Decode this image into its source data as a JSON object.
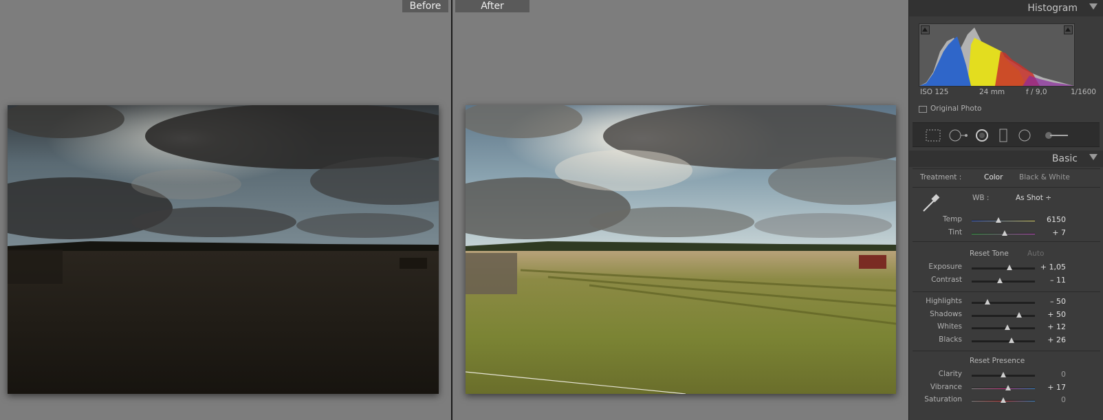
{
  "compare": {
    "before_label": "Before",
    "after_label": "After"
  },
  "histogram": {
    "title": "Histogram",
    "iso": "ISO 125",
    "focal": "24 mm",
    "aperture": "f / 9,0",
    "shutter": "1/1600",
    "original_photo": "Original Photo"
  },
  "basic": {
    "title": "Basic",
    "treatment_label": "Treatment :",
    "treatment_color": "Color",
    "treatment_bw": "Black & White",
    "wb_label": "WB :",
    "wb_value": "As Shot ÷",
    "temp": {
      "label": "Temp",
      "value": "6150",
      "pos": 0.42
    },
    "tint": {
      "label": "Tint",
      "value": "+ 7",
      "pos": 0.52
    },
    "reset_tone": "Reset Tone",
    "auto": "Auto",
    "exposure": {
      "label": "Exposure",
      "value": "+ 1,05",
      "pos": 0.6
    },
    "contrast": {
      "label": "Contrast",
      "value": "– 11",
      "pos": 0.45
    },
    "highlights": {
      "label": "Highlights",
      "value": "– 50",
      "pos": 0.25
    },
    "shadows": {
      "label": "Shadows",
      "value": "+ 50",
      "pos": 0.75
    },
    "whites": {
      "label": "Whites",
      "value": "+ 12",
      "pos": 0.56
    },
    "blacks": {
      "label": "Blacks",
      "value": "+ 26",
      "pos": 0.63
    },
    "reset_presence": "Reset Presence",
    "clarity": {
      "label": "Clarity",
      "value": "0",
      "pos": 0.5
    },
    "vibrance": {
      "label": "Vibrance",
      "value": "+ 17",
      "pos": 0.58
    },
    "saturation": {
      "label": "Saturation",
      "value": "0",
      "pos": 0.5
    }
  },
  "colors": {
    "panel_bg": "#3b3b3b",
    "center_bg": "#7d7d7d",
    "accent_text": "#e0e0e0"
  }
}
